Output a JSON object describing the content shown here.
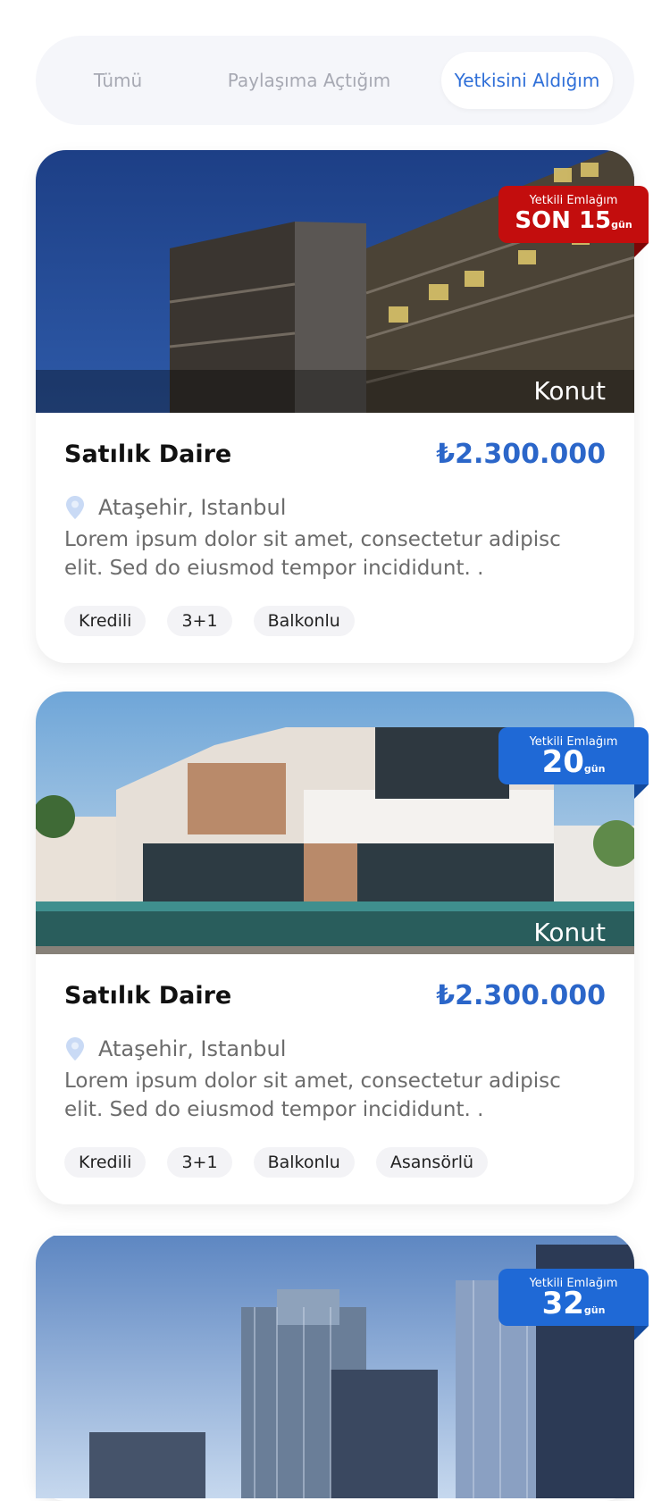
{
  "tabs": [
    {
      "label": "Tümü"
    },
    {
      "label": "Paylaşıma Açtığım"
    },
    {
      "label": "Yetkisini Aldığım"
    }
  ],
  "active_tab": "Yetkisini Aldığım",
  "listings": [
    {
      "property_type": "Konut",
      "badge": {
        "label": "Yetkili Emlağım",
        "value": "SON 15",
        "unit": "gün",
        "color": "#c30d0d"
      },
      "title": "Satılık Daire",
      "price": "₺2.300.000",
      "location": "Ataşehir, Istanbul",
      "description": "Lorem ipsum dolor sit amet, consectetur adipisc elit. Sed do eiusmod tempor incididunt. .",
      "tags": [
        "Kredili",
        "3+1",
        "Balkonlu"
      ]
    },
    {
      "property_type": "Konut",
      "badge": {
        "label": "Yetkili Emlağım",
        "value": "20",
        "unit": "gün",
        "color": "#1f69d6"
      },
      "title": "Satılık Daire",
      "price": "₺2.300.000",
      "location": "Ataşehir, Istanbul",
      "description": "Lorem ipsum dolor sit amet, consectetur adipisc elit. Sed do eiusmod tempor incididunt. .",
      "tags": [
        "Kredili",
        "3+1",
        "Balkonlu",
        "Asansörlü"
      ]
    },
    {
      "badge": {
        "label": "Yetkili Emlağım",
        "value": "32",
        "unit": "gün",
        "color": "#1f69d6"
      }
    }
  ],
  "icons": {
    "location": "location-pin-icon"
  },
  "colors": {
    "accent": "#2f6fd8",
    "price": "#2b66c9",
    "urgent": "#c30d0d"
  }
}
